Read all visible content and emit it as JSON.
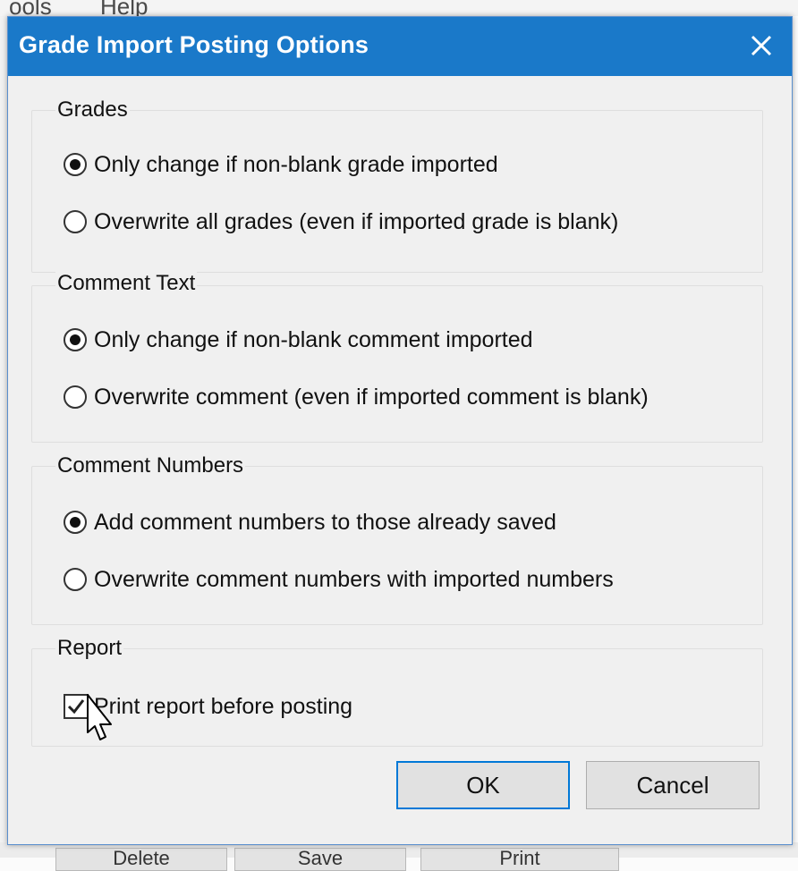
{
  "background": {
    "menu_items": [
      "ools",
      "Help"
    ],
    "buttons": [
      "Delete",
      "Save",
      "Print"
    ]
  },
  "dialog": {
    "title": "Grade Import Posting Options",
    "close_icon": "close-icon",
    "groups": [
      {
        "title": "Grades",
        "options": [
          {
            "label": "Only change if non-blank grade imported",
            "checked": true
          },
          {
            "label": "Overwrite all grades (even if imported grade is blank)",
            "checked": false
          }
        ]
      },
      {
        "title": "Comment Text",
        "options": [
          {
            "label": "Only change if non-blank comment imported",
            "checked": true
          },
          {
            "label": "Overwrite comment (even if imported comment is blank)",
            "checked": false
          }
        ]
      },
      {
        "title": "Comment Numbers",
        "options": [
          {
            "label": "Add comment numbers to those already saved",
            "checked": true
          },
          {
            "label": "Overwrite comment numbers with imported numbers",
            "checked": false
          }
        ]
      },
      {
        "title": "Report",
        "checkbox": {
          "label": "Print report before posting",
          "checked": true
        }
      }
    ],
    "ok_label": "OK",
    "cancel_label": "Cancel",
    "accent_color": "#1a79c9"
  }
}
